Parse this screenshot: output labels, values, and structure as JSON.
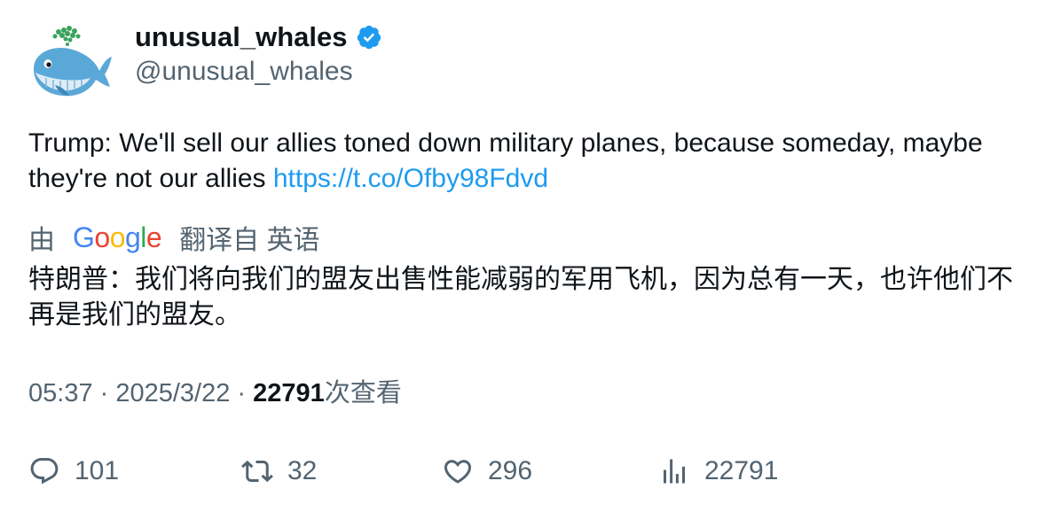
{
  "author": {
    "display_name": "unusual_whales",
    "handle": "@unusual_whales",
    "verified": true,
    "avatar_icon": "whale-avatar-icon"
  },
  "tweet": {
    "text": "Trump: We'll sell our allies toned down military planes, because someday, maybe they're not our allies ",
    "link": "https://t.co/Ofby98Fdvd"
  },
  "translation": {
    "prefix": "由",
    "provider": "Google",
    "suffix": "翻译自 英语",
    "text": "特朗普：我们将向我们的盟友出售性能减弱的军用飞机，因为总有一天，也许他们不再是我们的盟友。"
  },
  "meta": {
    "time": "05:37",
    "separator": " · ",
    "date": "2025/3/22",
    "views_count": "22791",
    "views_label": "次查看"
  },
  "actions": {
    "replies": "101",
    "retweets": "32",
    "likes": "296",
    "views": "22791"
  },
  "colors": {
    "link": "#1d9bf0",
    "muted": "#536471",
    "verified": "#1d9bf0",
    "google_blue": "#4285F4",
    "google_red": "#EA4335",
    "google_yellow": "#FBBC05",
    "google_green": "#34A853"
  }
}
